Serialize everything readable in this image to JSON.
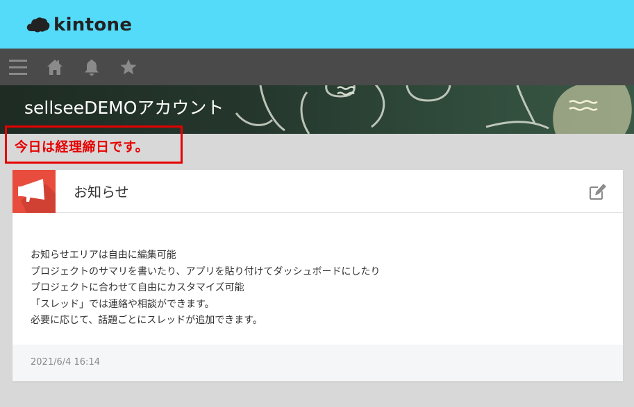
{
  "app": {
    "logo_text": "kintone"
  },
  "nav": {
    "icons": [
      "menu-icon",
      "home-icon",
      "bell-icon",
      "star-icon"
    ]
  },
  "space": {
    "name": "sellseeDEMOアカウント"
  },
  "notice": {
    "text": "今日は経理締日です。",
    "color": "#e60000"
  },
  "announcement": {
    "title": "お知らせ",
    "lines": [
      "お知らせエリアは自由に編集可能",
      "プロジェクトのサマリを書いたり、アプリを貼り付けてダッシュボードにしたり",
      "プロジェクトに合わせて自由にカスタマイズ可能",
      "「スレッド」では連絡や相談ができます。",
      "必要に応じて、話題ごとにスレッドが追加できます。"
    ],
    "timestamp": "2021/6/4 16:14"
  },
  "colors": {
    "brand": "#55dbfa",
    "nav": "#4a4a4a",
    "announcement_icon": "#e74c3c"
  }
}
